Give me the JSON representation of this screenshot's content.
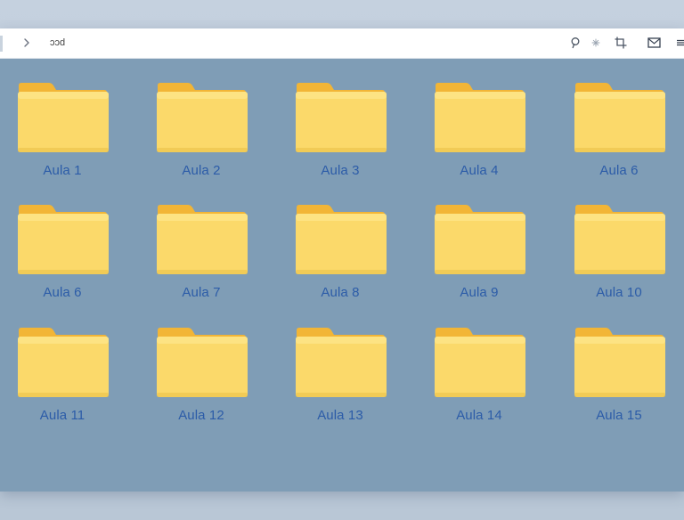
{
  "toolbar": {
    "path_text": "ɔɔd",
    "icons": [
      "chevron-right-icon",
      "search-icon",
      "sparkle-icon",
      "crop-icon",
      "mail-icon",
      "menu-icon"
    ]
  },
  "colors": {
    "folder_front": "#fbd96a",
    "folder_back": "#f2b536",
    "label": "#2c5ca8",
    "content_bg": "#7f9db6"
  },
  "folders": [
    {
      "label": "Aula 1"
    },
    {
      "label": "Aula 2"
    },
    {
      "label": "Aula 3"
    },
    {
      "label": "Aula 4"
    },
    {
      "label": "Aula 6"
    },
    {
      "label": "Aula 6"
    },
    {
      "label": "Aula 7"
    },
    {
      "label": "Aula 8"
    },
    {
      "label": "Aula 9"
    },
    {
      "label": "Aula 10"
    },
    {
      "label": "Aula 11"
    },
    {
      "label": "Aula 12"
    },
    {
      "label": "Aula 13"
    },
    {
      "label": "Aula 14"
    },
    {
      "label": "Aula 15"
    }
  ]
}
